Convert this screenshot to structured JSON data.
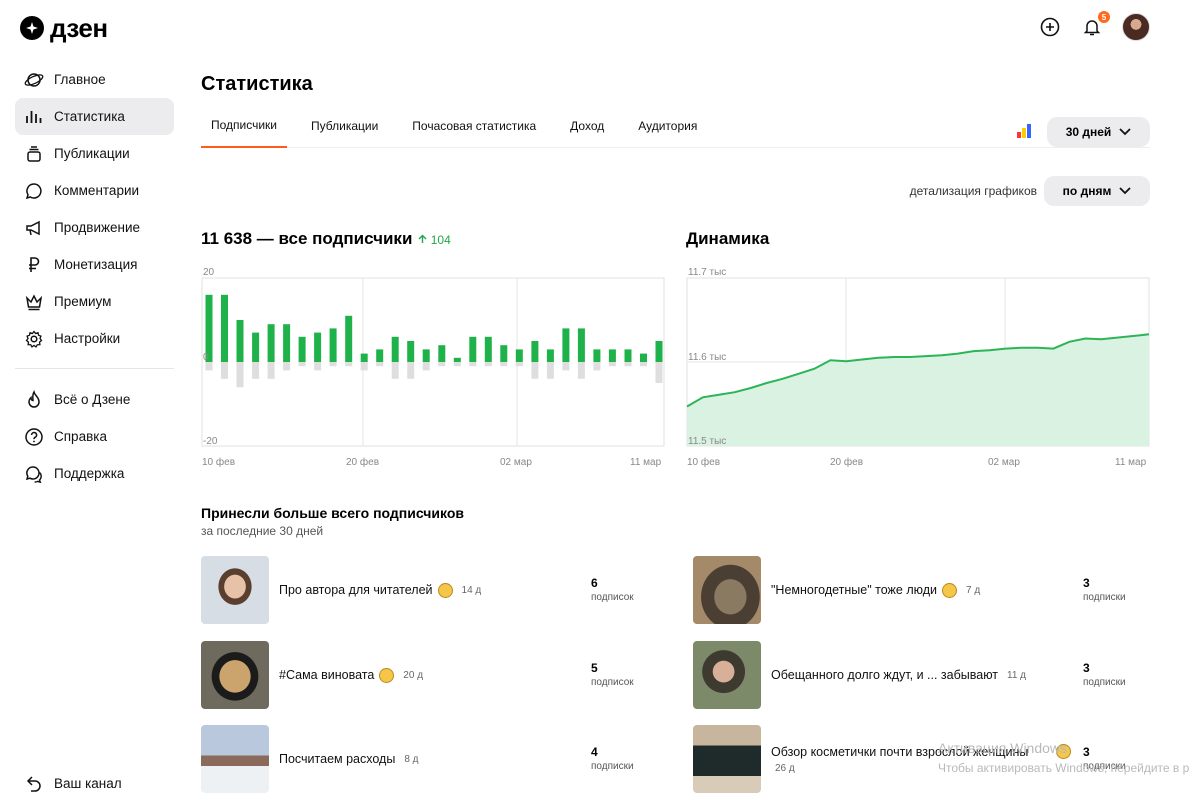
{
  "app": {
    "logo_text": "дзен",
    "notification_count": "5"
  },
  "sidebar": {
    "items": [
      {
        "label": "Главное",
        "icon": "planet-icon"
      },
      {
        "label": "Статистика",
        "icon": "stats-icon"
      },
      {
        "label": "Публикации",
        "icon": "publications-icon"
      },
      {
        "label": "Комментарии",
        "icon": "comment-icon"
      },
      {
        "label": "Продвижение",
        "icon": "megaphone-icon"
      },
      {
        "label": "Монетизация",
        "icon": "ruble-icon"
      },
      {
        "label": "Премиум",
        "icon": "crown-icon"
      },
      {
        "label": "Настройки",
        "icon": "gear-icon"
      }
    ],
    "secondary": [
      {
        "label": "Всё о Дзене",
        "icon": "flame-icon"
      },
      {
        "label": "Справка",
        "icon": "help-icon"
      },
      {
        "label": "Поддержка",
        "icon": "support-icon"
      }
    ],
    "bottom": {
      "label": "Ваш канал",
      "icon": "back-arrow-icon"
    }
  },
  "page": {
    "title": "Статистика"
  },
  "tabs": [
    "Подписчики",
    "Публикации",
    "Почасовая статистика",
    "Доход",
    "Аудитория"
  ],
  "period": {
    "value": "30 дней"
  },
  "detail": {
    "label": "детализация графиков",
    "value": "по дням"
  },
  "subscribers": {
    "heading": "11 638 — все подписчики",
    "growth": "104"
  },
  "dynamics": {
    "heading": "Динамика"
  },
  "chart_data": [
    {
      "type": "bar",
      "ylim": [
        -20,
        20
      ],
      "y_ticks": [
        "20",
        "0",
        "-20"
      ],
      "x_ticks": [
        "10 фев",
        "20 фев",
        "02 мар",
        "11 мар"
      ],
      "series": [
        {
          "values": [
            16,
            16,
            10,
            7,
            9,
            9,
            6,
            7,
            8,
            11,
            2,
            3,
            6,
            5,
            3,
            4,
            1,
            6,
            6,
            4,
            3,
            5,
            3,
            8,
            8,
            3,
            3,
            3,
            2,
            5
          ]
        },
        {
          "values": [
            -2,
            -4,
            -6,
            -4,
            -4,
            -2,
            -1,
            -2,
            -1,
            -1,
            -2,
            -1,
            -4,
            -4,
            -2,
            -1,
            -1,
            -1,
            -1,
            -1,
            -1,
            -4,
            -4,
            -2,
            -4,
            -2,
            -1,
            -1,
            -1,
            -5
          ]
        }
      ]
    },
    {
      "type": "area",
      "ylim": [
        11.5,
        11.7
      ],
      "y_ticks": [
        "11.7 тыс",
        "11.6 тыс",
        "11.5 тыс"
      ],
      "x_ticks": [
        "10 фев",
        "20 фев",
        "02 мар",
        "11 мар"
      ],
      "values": [
        11.547,
        11.558,
        11.561,
        11.564,
        11.569,
        11.575,
        11.58,
        11.586,
        11.592,
        11.602,
        11.601,
        11.603,
        11.605,
        11.606,
        11.606,
        11.607,
        11.608,
        11.61,
        11.613,
        11.614,
        11.616,
        11.617,
        11.617,
        11.616,
        11.624,
        11.628,
        11.627,
        11.629,
        11.631,
        11.633
      ]
    }
  ],
  "top": {
    "title": "Принесли больше всего подписчиков",
    "subtitle": "за последние 30 дней",
    "items": [
      {
        "title": "Про автора для читателей",
        "age": "14 д",
        "count": "6",
        "unit": "подписок"
      },
      {
        "title": "\"Немногодетные\" тоже люди",
        "age": "7 д",
        "count": "3",
        "unit": "подписки"
      },
      {
        "title": "#Сама виновата",
        "age": "20 д",
        "count": "5",
        "unit": "подписок"
      },
      {
        "title": "Обещанного долго ждут, и ... забывают",
        "age": "11 д",
        "count": "3",
        "unit": "подписки"
      },
      {
        "title": "Посчитаем расходы",
        "age": "8 д",
        "count": "4",
        "unit": "подписки"
      },
      {
        "title": "Обзор косметички почти взрослой женщины",
        "age": "26 д",
        "count": "3",
        "unit": "подписки"
      }
    ]
  },
  "watermark": {
    "line1": "Активация Windows",
    "line2": "Чтобы активировать Windows, перейдите в р"
  }
}
